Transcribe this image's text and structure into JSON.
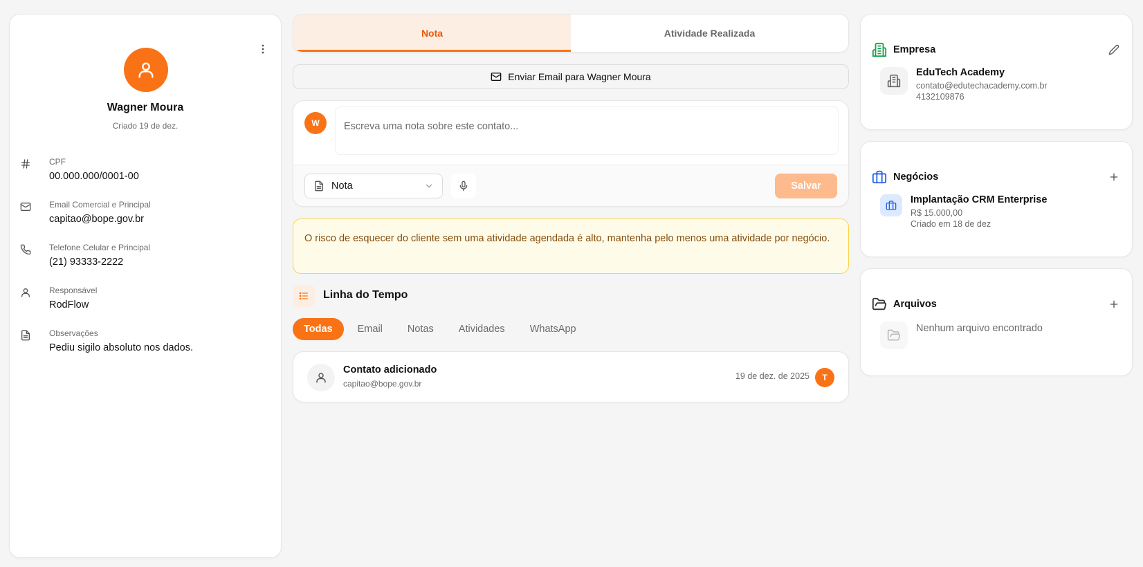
{
  "contact": {
    "avatar_icon": "user-icon",
    "name": "Wagner Moura",
    "created": "Criado 19 de dez.",
    "fields": [
      {
        "icon": "hash-icon",
        "label": "CPF",
        "value": "00.000.000/0001-00"
      },
      {
        "icon": "mail-icon",
        "label": "Email Comercial e Principal",
        "value": "capitao@bope.gov.br"
      },
      {
        "icon": "phone-icon",
        "label": "Telefone Celular e Principal",
        "value": "(21) 93333-2222"
      },
      {
        "icon": "user-icon",
        "label": "Responsável",
        "value": "RodFlow"
      },
      {
        "icon": "file-text-icon",
        "label": "Observações",
        "value": "Pediu sigilo absoluto nos dados."
      }
    ]
  },
  "tabs": [
    {
      "label": "Nota",
      "active": true
    },
    {
      "label": "Atividade Realizada",
      "active": false
    }
  ],
  "email_button": {
    "label": "Enviar Email para Wagner Moura",
    "icon": "mail-icon"
  },
  "note_editor": {
    "avatar_initial": "W",
    "placeholder": "Escreva uma nota sobre este contato...",
    "type_select": {
      "value": "Nota",
      "icon": "file-text-icon"
    },
    "mic_icon": "mic-icon",
    "save_label": "Salvar"
  },
  "alert": {
    "text": "O risco de esquecer do cliente sem uma atividade agendada é alto, mantenha pelo menos uma atividade por negócio."
  },
  "timeline": {
    "title": "Linha do Tempo",
    "icon": "list-icon",
    "filters": [
      "Todas",
      "Email",
      "Notas",
      "Atividades",
      "WhatsApp"
    ],
    "active_filter": "Todas",
    "items": [
      {
        "title": "Contato adicionado",
        "subtitle": "capitao@bope.gov.br",
        "date": "19 de dez. de 2025",
        "user_initial": "T"
      }
    ]
  },
  "company": {
    "title": "Empresa",
    "name": "EduTech Academy",
    "email": "contato@edutechacademy.com.br",
    "phone": "4132109876",
    "accent": "#16a34a"
  },
  "deals": {
    "title": "Negócios",
    "items": [
      {
        "name": "Implantação CRM Enterprise",
        "value": "R$ 15.000,00",
        "created": "Criado em 18 de dez"
      }
    ],
    "accent": "#2563eb"
  },
  "files": {
    "title": "Arquivos",
    "empty_text": "Nenhum arquivo encontrado"
  },
  "colors": {
    "brand": "#f97316",
    "brand_light": "#fdeee4",
    "alert_bg": "#fefce8",
    "alert_border": "#fcd34d",
    "alert_text": "#854d0e"
  }
}
